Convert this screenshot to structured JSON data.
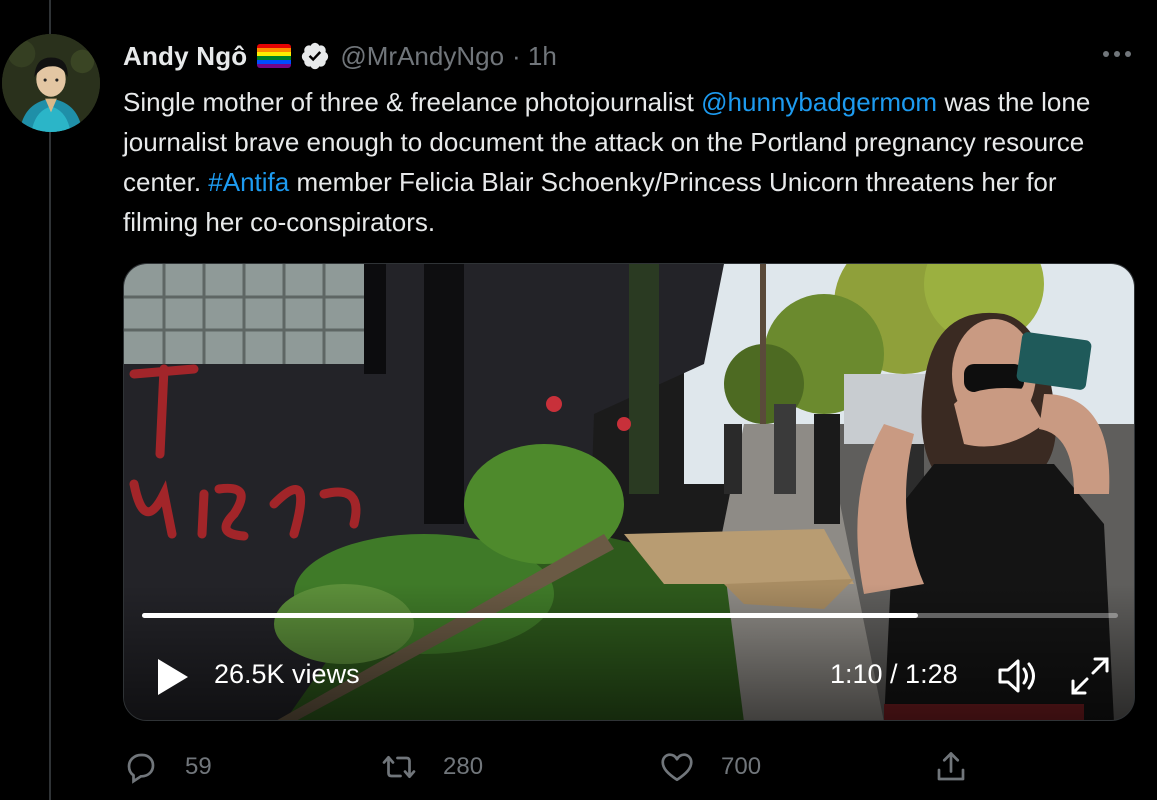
{
  "tweet": {
    "author": {
      "display_name": "Andy Ngô",
      "handle": "@MrAndyNgo",
      "time": "· 1h",
      "flag_icon": "rainbow-flag-emoji",
      "verified_icon": "verified-badge-icon"
    },
    "text": {
      "part1": "Single mother of three & freelance photojournalist ",
      "mention": "@hunnybadgermom",
      "part2": " was the lone journalist brave enough to document the attack on the Portland pregnancy resource center. ",
      "hashtag": "#Antifa",
      "part3": " member Felicia Blair Schoenky/Princess Unicorn threatens her for filming her co-conspirators."
    },
    "video": {
      "views": "26.5K views",
      "time": "1:10 / 1:28",
      "progress": 0.795
    },
    "actions": {
      "reply_count": "59",
      "retweet_count": "280",
      "like_count": "700"
    }
  },
  "colors": {
    "background": "#000000",
    "text": "#e7e9ea",
    "secondary": "#71767b",
    "link": "#1d9bf0",
    "border": "#2f3336"
  }
}
